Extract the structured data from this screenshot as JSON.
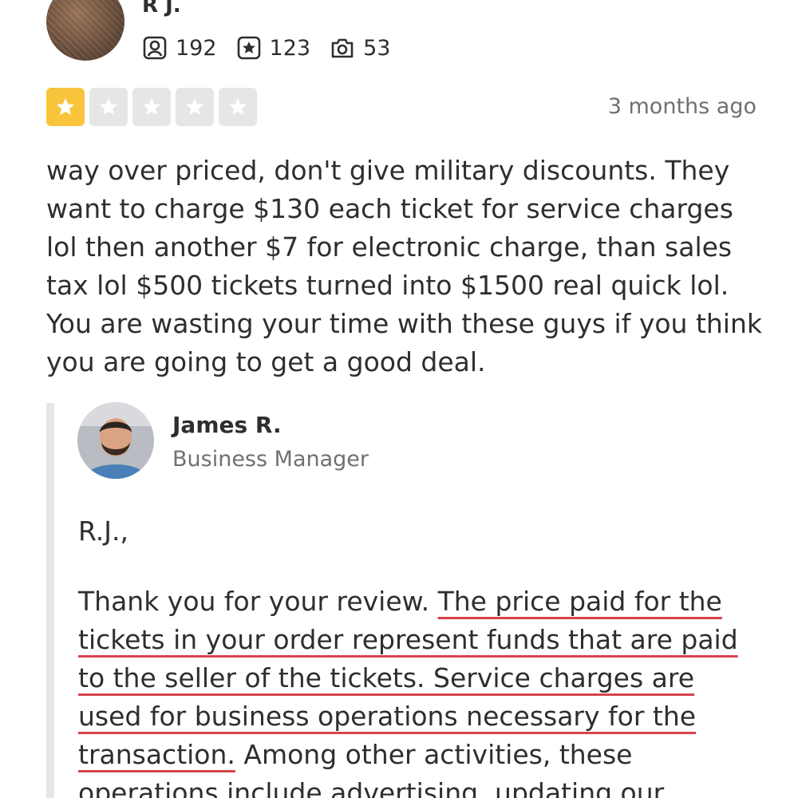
{
  "reviewer": {
    "name": "R J.",
    "stats": {
      "reviews": "192",
      "photos": "123",
      "friends": "53"
    }
  },
  "rating": {
    "stars": 1,
    "max": 5,
    "date": "3 months ago"
  },
  "review": {
    "text": "way over priced, don't give military discounts. They want to charge $130 each ticket for service charges lol then another $7 for electronic charge, than sales tax lol $500 tickets turned into $1500 real quick lol. You are wasting your time with these guys if you think you are going to get a good deal."
  },
  "reply": {
    "name": "James R.",
    "role": "Business Manager",
    "greeting": "R.J.,",
    "intro": "Thank you for your review. ",
    "highlighted": "The price paid for the tickets in your order represent funds that are paid to the seller of the tickets. Service charges are used for business operations necessary for the transaction.",
    "continuation": " Among other activities, these operations include advertising, updating our"
  },
  "colors": {
    "star_filled": "#f7c43c",
    "star_empty": "#e6e6e6",
    "highlight_underline": "#d9434a",
    "muted_text": "#6e7072"
  },
  "icons": {
    "reviews": "review-icon",
    "photos": "star-badge-icon",
    "friends": "camera-icon"
  }
}
